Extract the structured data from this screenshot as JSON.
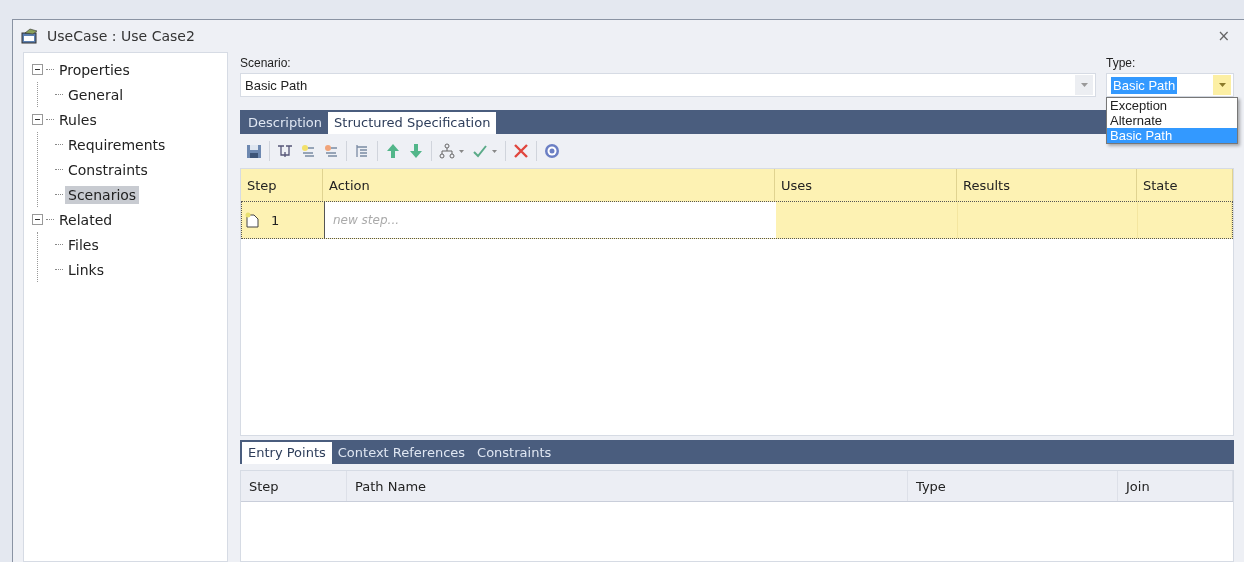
{
  "window": {
    "title": "UseCase : Use Case2",
    "close": "×"
  },
  "tree": [
    {
      "label": "Properties",
      "expanded": true,
      "selected": false,
      "children": [
        {
          "label": "General",
          "selected": false
        }
      ]
    },
    {
      "label": "Rules",
      "expanded": true,
      "selected": false,
      "children": [
        {
          "label": "Requirements",
          "selected": false
        },
        {
          "label": "Constraints",
          "selected": false
        },
        {
          "label": "Scenarios",
          "selected": true
        }
      ]
    },
    {
      "label": "Related",
      "expanded": true,
      "selected": false,
      "children": [
        {
          "label": "Files",
          "selected": false
        },
        {
          "label": "Links",
          "selected": false
        }
      ]
    }
  ],
  "scenario": {
    "label": "Scenario:",
    "value": "Basic Path"
  },
  "type": {
    "label": "Type:",
    "value": "Basic Path",
    "expanded": true,
    "options": [
      {
        "label": "Exception",
        "selected": false
      },
      {
        "label": "Alternate",
        "selected": false
      },
      {
        "label": "Basic Path",
        "selected": true
      }
    ]
  },
  "tabs": [
    {
      "label": "Description",
      "selected": false
    },
    {
      "label": "Structured Specification",
      "selected": true
    }
  ],
  "steps_table": {
    "columns": [
      "Step",
      "Action",
      "Uses",
      "Results",
      "State"
    ],
    "rows": [
      {
        "step": "1",
        "placeholder": "new step..."
      }
    ]
  },
  "bottom_tabs": [
    {
      "label": "Entry Points",
      "selected": true
    },
    {
      "label": "Context References",
      "selected": false
    },
    {
      "label": "Constraints",
      "selected": false
    }
  ],
  "entry_points_table": {
    "columns": [
      "Step",
      "Path Name",
      "Type",
      "Join"
    ]
  }
}
